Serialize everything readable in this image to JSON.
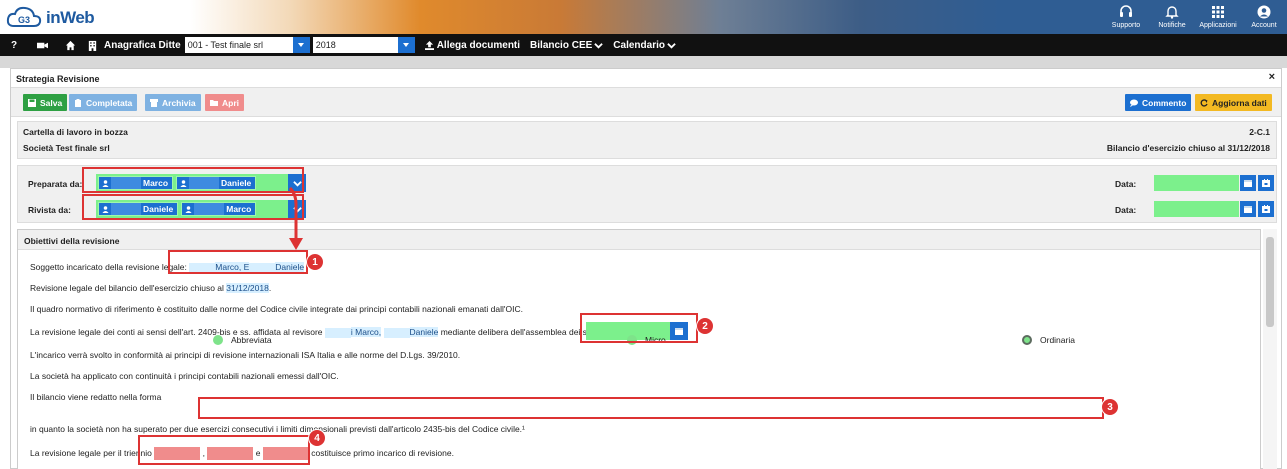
{
  "brand": {
    "logo_text": "inWeb",
    "logo_mark": "G3"
  },
  "top_actions": [
    {
      "label": "Supporto",
      "icon": "headset-icon"
    },
    {
      "label": "Notifiche",
      "icon": "bell-icon"
    },
    {
      "label": "Applicazioni",
      "icon": "grid-icon"
    },
    {
      "label": "Account",
      "icon": "account-icon"
    }
  ],
  "navbar": {
    "help": "?",
    "anagrafica_label": "Anagrafica Ditte",
    "company_select": "001 - Test finale srl",
    "year_select": "2018",
    "allega": "Allega documenti",
    "bilancio": "Bilancio CEE",
    "calendario": "Calendario"
  },
  "panel": {
    "title": "Strategia Revisione",
    "close": "×",
    "buttons": {
      "salva": "Salva",
      "completata": "Completata",
      "archivia": "Archivia",
      "apri": "Apri",
      "commento": "Commento",
      "aggiorna": "Aggiorna dati"
    },
    "info": {
      "status": "Cartella di lavoro in bozza",
      "company": "Società Test finale srl",
      "code": "2-C.1",
      "bilancio": "Bilancio d'esercizio chiuso al 31/12/2018"
    },
    "preparata": {
      "label": "Preparata da:",
      "users": [
        "Marco",
        "Daniele"
      ],
      "date_label": "Data:"
    },
    "rivista": {
      "label": "Rivista da:",
      "users": [
        "Daniele",
        "Marco"
      ],
      "date_label": "Data:"
    },
    "obiettivi": {
      "title": "Obiettivi della revisione",
      "l1_pre": "Soggetto incaricato della revisione legale:",
      "l1_names": "Marco, E",
      "l1_name2": "Daniele",
      "l2_pre": "Revisione legale del bilancio dell'esercizio chiuso al ",
      "l2_date": "31/12/2018",
      "l2_post": ".",
      "l3": "Il quadro normativo di riferimento è costituito dalle norme del Codice civile integrate dai principi contabili nazionali emanati dall'OIC.",
      "l4_pre": "La revisione legale dei conti ai sensi dell'art. 2409-bis e ss. affidata al revisore",
      "l4_name1": "i Marco,",
      "l4_name2": "Daniele",
      "l4_post": "mediante delibera dell'assemblea dei soci del",
      "l5": "L'incarico verrà svolto in conformità ai principi di revisione internazionali ISA Italia e alle norme del D.Lgs. 39/2010.",
      "l6": "La società ha applicato con continuità i principi contabili nazionali emessi dall'OIC.",
      "l7": "Il bilancio viene redatto nella forma",
      "radios": [
        "Abbreviata",
        "Micro",
        "Ordinaria"
      ],
      "selected": "Ordinaria",
      "l8": "in quanto la società non ha superato per due esercizi consecutivi i limiti dimensionali previsti dall'articolo 2435-bis del Codice civile.¹",
      "l9_pre": "La revisione legale per il triennio",
      "l9_sep1": ",",
      "l9_sep2": "e",
      "l9_post": "costituisce primo incarico di revisione."
    }
  },
  "badges": [
    "1",
    "2",
    "3",
    "4"
  ],
  "colors": {
    "accent": "#1c6fd0",
    "success": "#2ea043",
    "highlight_green": "#7cf08c",
    "annotation_red": "#dd3333",
    "warning": "#f3b922"
  }
}
